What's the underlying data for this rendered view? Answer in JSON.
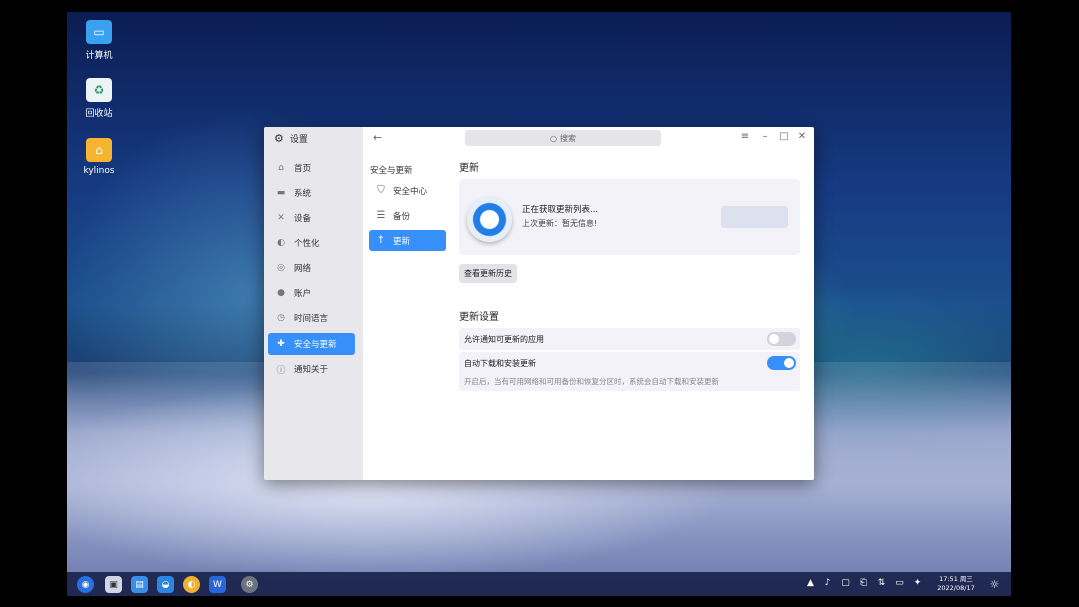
{
  "desktop": {
    "icons": [
      {
        "label": "计算机",
        "icon": "computer-icon"
      },
      {
        "label": "回收站",
        "icon": "trash-icon"
      },
      {
        "label": "kylinos",
        "icon": "folder-home-icon"
      }
    ]
  },
  "window": {
    "app_title": "设置",
    "search_placeholder": "搜索",
    "sidebar": [
      {
        "label": "首页",
        "glyph": "⌂"
      },
      {
        "label": "系统",
        "glyph": "▬"
      },
      {
        "label": "设备",
        "glyph": "✕"
      },
      {
        "label": "个性化",
        "glyph": "◐"
      },
      {
        "label": "网络",
        "glyph": "◎"
      },
      {
        "label": "账户",
        "glyph": "●"
      },
      {
        "label": "时间语言",
        "glyph": "◷"
      },
      {
        "label": "安全与更新",
        "glyph": "✚",
        "active": true
      },
      {
        "label": "通知关于",
        "glyph": "ⓘ"
      }
    ],
    "subnav": {
      "title": "安全与更新",
      "items": [
        {
          "label": "安全中心",
          "glyph": "⛉"
        },
        {
          "label": "备份",
          "glyph": "☰"
        },
        {
          "label": "更新",
          "glyph": "↑",
          "active": true
        }
      ]
    },
    "main": {
      "update_heading": "更新",
      "status_text": "正在获取更新列表...",
      "last_update": "上次更新：暂无信息!",
      "history_button": "查看更新历史",
      "settings_heading": "更新设置",
      "setting1_label": "允许通知可更新的应用",
      "setting1_on": false,
      "setting2_label": "自动下载和安装更新",
      "setting2_on": true,
      "setting2_desc": "开启后，当有可用网络和可用备份和恢复分区时，系统会自动下载和安装更新"
    }
  },
  "taskbar": {
    "clock_time": "17:51 周三",
    "clock_date": "2022/08/17"
  },
  "colors": {
    "accent": "#3790fa",
    "sidebar_bg": "#e7e7ec",
    "card_bg": "#f2f2f8"
  }
}
